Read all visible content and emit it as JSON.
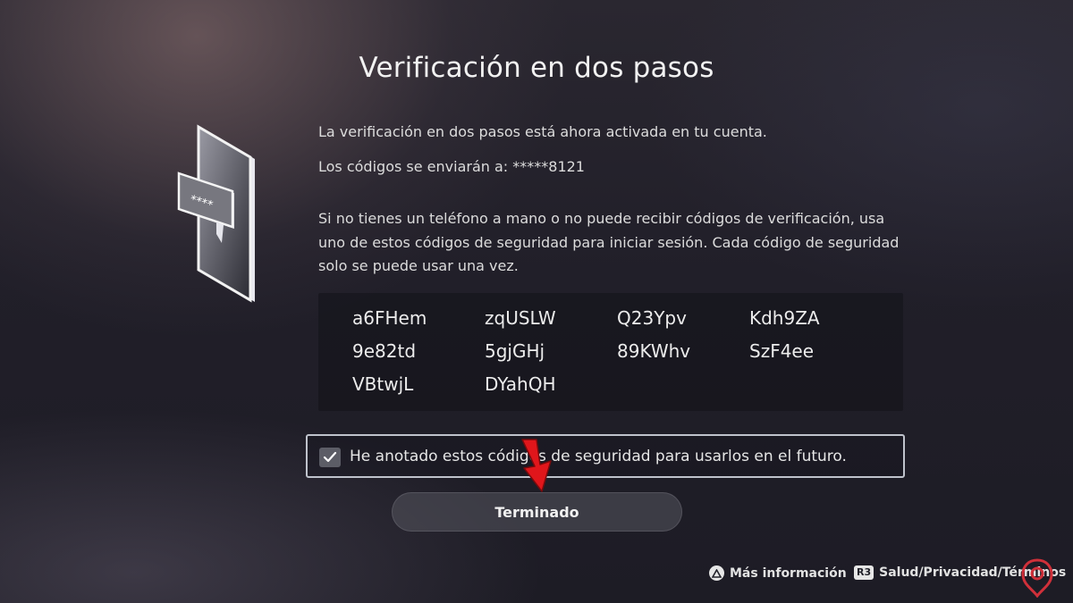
{
  "title": "Verificación en dos pasos",
  "status_line": "La verificación en dos pasos está ahora activada en tu cuenta.",
  "codes_sent_line": "Los códigos se enviarán a: *****8121",
  "info_paragraph": "Si no tienes un teléfono a mano o no puede recibir códigos de verificación, usa uno de estos códigos de seguridad para iniciar sesión. Cada código de seguridad solo se puede usar una vez.",
  "security_codes": [
    "a6FHem",
    "zqUSLW",
    "Q23Ypv",
    "Kdh9ZA",
    "9e82td",
    "5gjGHj",
    "89KWhv",
    "SzF4ee",
    "VBtwjL",
    "DYahQH"
  ],
  "checkbox": {
    "label": "He anotado estos códigos de seguridad para usarlos en el futuro.",
    "checked": true
  },
  "done_button": "Terminado",
  "footer": {
    "more_info": "Más información",
    "r3_badge": "R3",
    "health_privacy_terms": "Salud/Privacidad/Términos"
  },
  "icons": {
    "illustration": "phone-sms-icon",
    "check": "check-icon",
    "triangle_button": "triangle-button-icon",
    "arrow": "red-arrow-icon"
  },
  "colors": {
    "arrow": "#e0161b",
    "watermark": "#d0303a"
  }
}
